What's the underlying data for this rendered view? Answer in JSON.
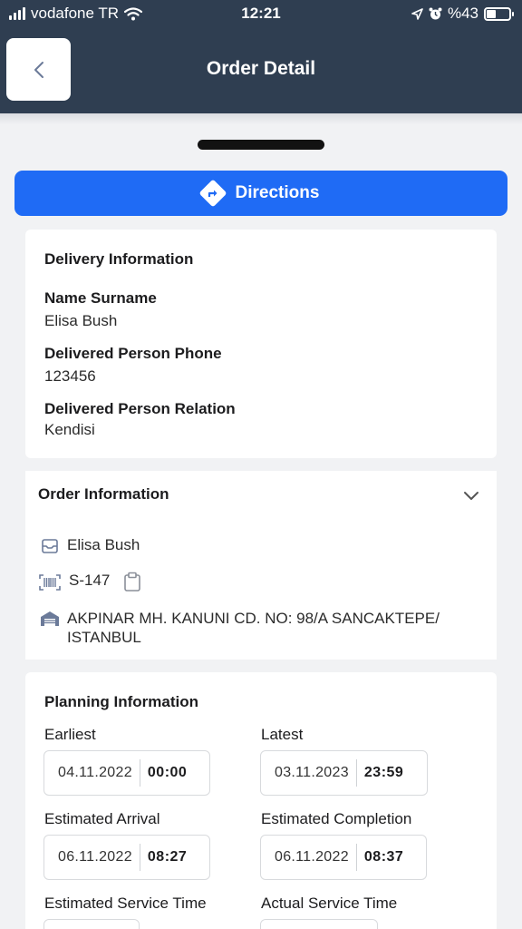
{
  "status_bar": {
    "carrier": "vodafone TR",
    "time": "12:21",
    "battery": "%43",
    "battery_level": 0.43
  },
  "header": {
    "title": "Order Detail",
    "back_icon": "chevron-left-icon"
  },
  "directions": {
    "label": "Directions",
    "icon": "directions-icon",
    "color": "#1f6bf5"
  },
  "delivery": {
    "title": "Delivery Information",
    "name_label": "Name Surname",
    "name_value": "Elisa Bush",
    "phone_label": "Delivered Person Phone",
    "phone_value": "123456",
    "relation_label": "Delivered Person Relation",
    "relation_value": "Kendisi"
  },
  "order": {
    "title": "Order Information",
    "recipient": "Elisa Bush",
    "code": "S-147",
    "address": "AKPINAR MH. KANUNI CD. NO: 98/A SANCAKTEPE/ ISTANBUL"
  },
  "planning": {
    "title": "Planning Information",
    "earliest": {
      "label": "Earliest",
      "date": "04.11.2022",
      "time": "00:00"
    },
    "latest": {
      "label": "Latest",
      "date": "03.11.2023",
      "time": "23:59"
    },
    "estimated_arrival": {
      "label": "Estimated Arrival",
      "date": "06.11.2022",
      "time": "08:27"
    },
    "estimated_completion": {
      "label": "Estimated Completion",
      "date": "06.11.2022",
      "time": "08:37"
    },
    "estimated_service_time": {
      "label": "Estimated Service Time"
    },
    "actual_service_time": {
      "label": "Actual Service Time"
    }
  },
  "colors": {
    "header_bg": "#2f3e51",
    "accent": "#1f6bf5",
    "icon": "#6b7a99"
  }
}
